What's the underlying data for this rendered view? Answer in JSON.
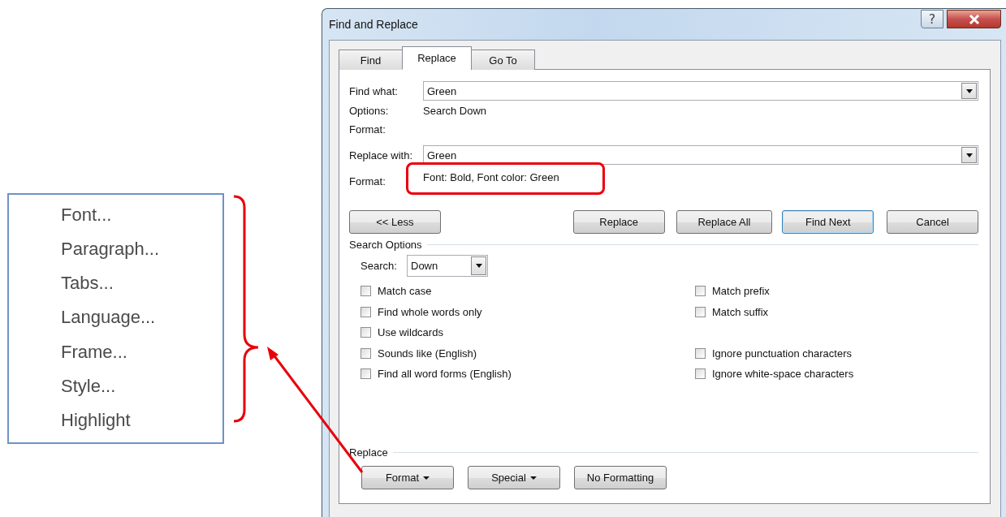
{
  "format_menu": {
    "items": [
      {
        "label": "Font..."
      },
      {
        "label": "Paragraph..."
      },
      {
        "label": "Tabs..."
      },
      {
        "label": "Language..."
      },
      {
        "label": "Frame..."
      },
      {
        "label": "Style..."
      },
      {
        "label": "Highlight"
      }
    ]
  },
  "window": {
    "title": "Find and Replace",
    "help_button": "?"
  },
  "tabs": [
    {
      "label": "Find",
      "selected": false
    },
    {
      "label": "Replace",
      "selected": true
    },
    {
      "label": "Go To",
      "selected": false
    }
  ],
  "find": {
    "label": "Find what:",
    "value": "Green",
    "options_label": "Options:",
    "options_value": "Search Down",
    "format_label": "Format:"
  },
  "replace": {
    "label": "Replace with:",
    "value": "Green",
    "format_label": "Format:",
    "format_value": "Font: Bold, Font color: Green"
  },
  "buttons": [
    {
      "label": "<< Less",
      "default": false
    },
    {
      "label": "Replace",
      "default": false
    },
    {
      "label": "Replace All",
      "default": false
    },
    {
      "label": "Find Next",
      "default": true
    },
    {
      "label": "Cancel",
      "default": false
    }
  ],
  "search_options": {
    "title": "Search Options",
    "search_label": "Search:",
    "search_value": "Down",
    "rows": [
      {
        "left": {
          "label": "Match case",
          "checked": false
        },
        "right": {
          "label": "Match prefix",
          "checked": false
        }
      },
      {
        "left": {
          "label": "Find whole words only",
          "checked": false
        },
        "right": {
          "label": "Match suffix",
          "checked": false
        }
      },
      {
        "left": {
          "label": "Use wildcards",
          "checked": false
        }
      },
      {
        "left": {
          "label": "Sounds like (English)",
          "checked": false
        },
        "right": {
          "label": "Ignore punctuation characters",
          "checked": false
        }
      },
      {
        "left": {
          "label": "Find all word forms (English)",
          "checked": false
        },
        "right": {
          "label": "Ignore white-space characters",
          "checked": false
        }
      }
    ]
  },
  "replace_group": {
    "title": "Replace",
    "buttons": [
      {
        "label": "Format",
        "dropdown": true
      },
      {
        "label": "Special",
        "dropdown": true
      },
      {
        "label": "No Formatting",
        "dropdown": false
      }
    ]
  }
}
